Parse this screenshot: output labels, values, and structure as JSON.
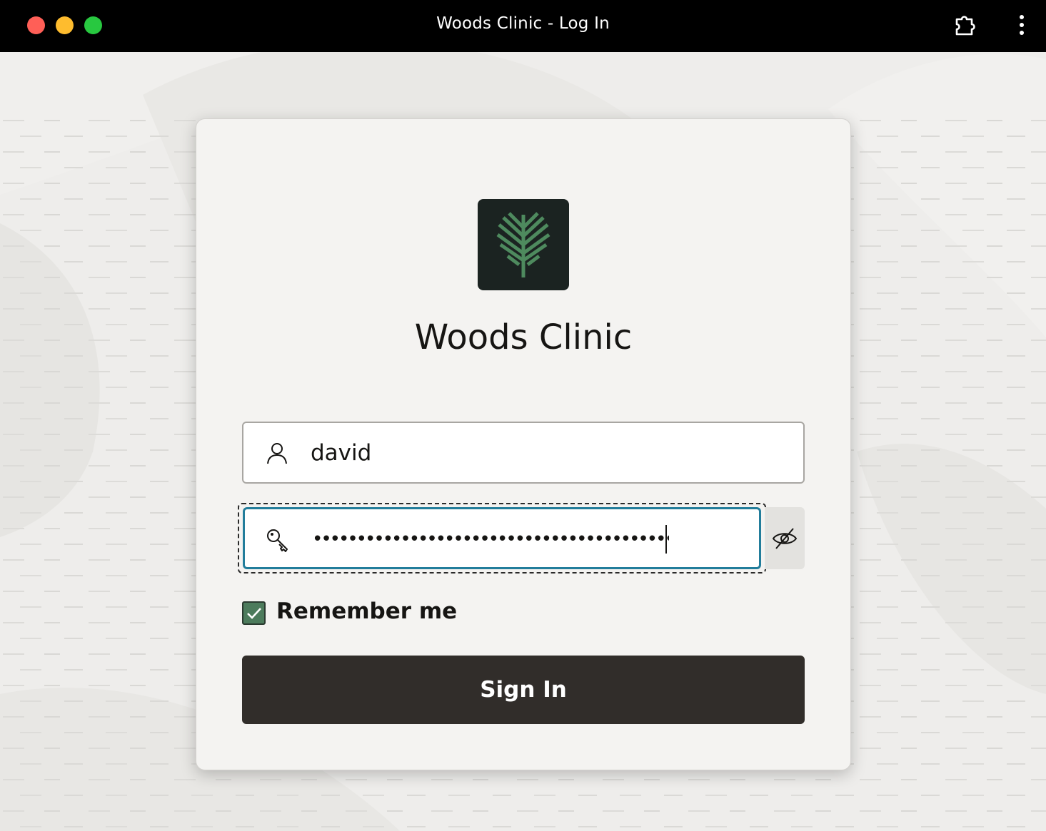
{
  "window": {
    "title": "Woods Clinic - Log In",
    "traffic_lights": {
      "close": "#ff5f57",
      "minimize": "#febc2e",
      "maximize": "#28c840"
    },
    "toolbar_icons": [
      "puzzle-extension-icon",
      "more-vertical-icon"
    ]
  },
  "login": {
    "logo_icon": "tree-logo-icon",
    "logo_colors": {
      "background": "#1b2321",
      "tree": "#4e8a5e"
    },
    "app_name": "Woods Clinic",
    "username": {
      "icon": "user-icon",
      "value": "david"
    },
    "password": {
      "icon": "key-icon",
      "masked_value": "•••••••••••••••••••••••••••••••••••••••••",
      "reveal_icon": "eye-off-icon",
      "focused": true
    },
    "remember_me": {
      "label": "Remember me",
      "checked": true
    },
    "sign_in_label": "Sign In"
  },
  "colors": {
    "accent_focus": "#227d9b",
    "checkbox": "#4c7b5c",
    "button": "#312d2a",
    "background": "#edecea",
    "card": "#f4f3f1"
  }
}
